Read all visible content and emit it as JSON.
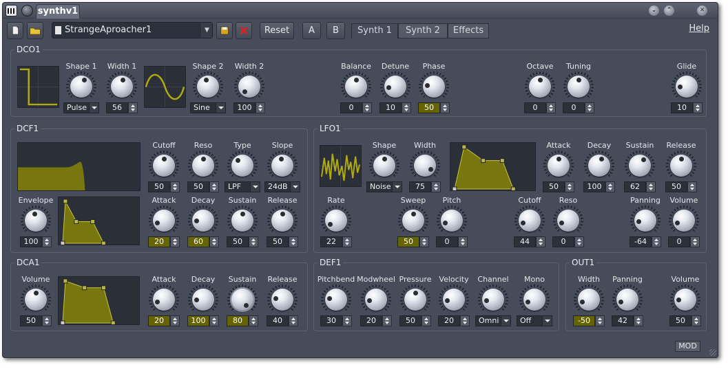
{
  "window": {
    "title": "synthv1",
    "buttons": [
      "minimize",
      "maximize",
      "close"
    ]
  },
  "toolbar": {
    "preset_name": "StrangeAproacher1",
    "reset_label": "Reset",
    "a_label": "A",
    "b_label": "B",
    "tabs": [
      "Synth 1",
      "Synth 2",
      "Effects"
    ],
    "active_tab": "Synth 1",
    "help_label": "Help",
    "icons": [
      "new-file-icon",
      "open-folder-icon",
      "save-icon",
      "delete-icon"
    ]
  },
  "colors": {
    "accent": "#6b6a00",
    "accent_fill": "#77760f",
    "knob_highlight": "#656400",
    "background": "#474c5a"
  },
  "panels": {
    "dco1": {
      "title": "DCO1",
      "controls": [
        {
          "label": "Shape 1",
          "combo": "Pulse",
          "angle": 25
        },
        {
          "label": "Width 1",
          "value": "56",
          "angle": 10
        },
        {
          "label": "Shape 2",
          "combo": "Sine",
          "angle": -15
        },
        {
          "label": "Width 2",
          "value": "100",
          "angle": -140
        },
        {
          "label": "Balance",
          "value": "0",
          "angle": 0
        },
        {
          "label": "Detune",
          "value": "10",
          "angle": -100
        },
        {
          "label": "Phase",
          "value": "50",
          "hl": true,
          "angle": -80
        },
        {
          "label": "Octave",
          "value": "0",
          "angle": 0
        },
        {
          "label": "Tuning",
          "value": "0",
          "angle": 0
        },
        {
          "label": "Glide",
          "value": "10",
          "angle": -90
        }
      ]
    },
    "dcf1": {
      "title": "DCF1",
      "controls": [
        {
          "label": "Cutoff",
          "value": "50",
          "angle": 0
        },
        {
          "label": "Reso",
          "value": "50",
          "angle": 0
        },
        {
          "label": "Type",
          "combo": "LPF",
          "angle": -40
        },
        {
          "label": "Slope",
          "combo": "24dB",
          "angle": -10
        },
        {
          "label": "Envelope",
          "value": "100",
          "angle": -10
        },
        {
          "label": "Attack",
          "value": "20",
          "hl": true,
          "angle": -110
        },
        {
          "label": "Decay",
          "value": "60",
          "hl": true,
          "angle": -90
        },
        {
          "label": "Sustain",
          "value": "50",
          "angle": 0
        },
        {
          "label": "Release",
          "value": "50",
          "angle": 0
        }
      ]
    },
    "lfo1": {
      "title": "LFO1",
      "controls": [
        {
          "label": "Shape",
          "combo": "Noise",
          "angle": 0
        },
        {
          "label": "Width",
          "value": "75",
          "angle": 120
        },
        {
          "label": "Attack",
          "value": "50",
          "angle": 0
        },
        {
          "label": "Decay",
          "value": "100",
          "angle": 20
        },
        {
          "label": "Sustain",
          "value": "62",
          "angle": 30
        },
        {
          "label": "Release",
          "value": "50",
          "angle": 0
        },
        {
          "label": "Rate",
          "value": "22",
          "angle": -120
        },
        {
          "label": "Sweep",
          "value": "50",
          "hl": true,
          "angle": 0
        },
        {
          "label": "Pitch",
          "value": "0",
          "angle": -110
        },
        {
          "label": "Cutoff",
          "value": "44",
          "angle": -110
        },
        {
          "label": "Reso",
          "value": "0",
          "angle": -110
        },
        {
          "label": "Panning",
          "value": "-64",
          "angle": -100
        },
        {
          "label": "Volume",
          "value": "0",
          "angle": -110
        }
      ]
    },
    "dca1": {
      "title": "DCA1",
      "controls": [
        {
          "label": "Volume",
          "value": "50",
          "angle": 0
        },
        {
          "label": "Attack",
          "value": "20",
          "hl": true,
          "angle": -110
        },
        {
          "label": "Decay",
          "value": "100",
          "hl": true,
          "angle": -90
        },
        {
          "label": "Sustain",
          "value": "80",
          "hl": true,
          "angle": 145,
          "knob_hl": true
        },
        {
          "label": "Release",
          "value": "40",
          "angle": -80
        }
      ]
    },
    "def1": {
      "title": "DEF1",
      "controls": [
        {
          "label": "Pitchbend",
          "value": "30",
          "angle": -80
        },
        {
          "label": "Modwheel",
          "value": "20",
          "angle": -100
        },
        {
          "label": "Pressure",
          "value": "50",
          "angle": 0
        },
        {
          "label": "Velocity",
          "value": "20",
          "angle": -100
        },
        {
          "label": "Channel",
          "combo": "Omni",
          "angle": -100
        },
        {
          "label": "Mono",
          "combo": "Off",
          "angle": -110
        }
      ]
    },
    "out1": {
      "title": "OUT1",
      "controls": [
        {
          "label": "Width",
          "value": "-50",
          "hl": true,
          "angle": -110
        },
        {
          "label": "Panning",
          "value": "42",
          "angle": -110
        },
        {
          "label": "Volume",
          "value": "50",
          "angle": -90
        }
      ]
    }
  },
  "status": {
    "mod_label": "MOD"
  }
}
